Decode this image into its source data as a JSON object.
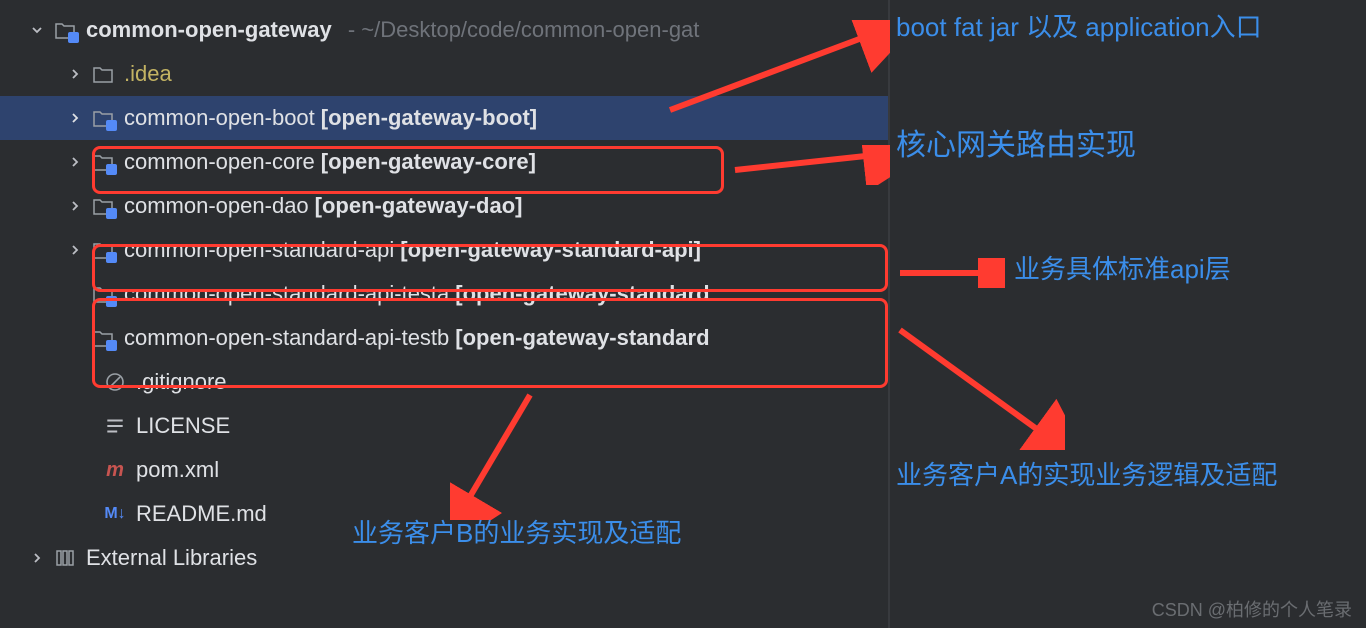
{
  "root": {
    "name": "common-open-gateway",
    "path": "~/Desktop/code/common-open-gat"
  },
  "items": [
    {
      "name": ".idea",
      "type": "folder-idea",
      "indent": 1,
      "chevron": "right"
    },
    {
      "name": "common-open-boot",
      "suffix": "[open-gateway-boot]",
      "type": "module",
      "indent": 1,
      "chevron": "right",
      "selected": true
    },
    {
      "name": "common-open-core",
      "suffix": "[open-gateway-core]",
      "type": "module",
      "indent": 1,
      "chevron": "right"
    },
    {
      "name": "common-open-dao",
      "suffix": "[open-gateway-dao]",
      "type": "module",
      "indent": 1,
      "chevron": "right"
    },
    {
      "name": "common-open-standard-api",
      "suffix": "[open-gateway-standard-api]",
      "type": "module",
      "indent": 1,
      "chevron": "right"
    },
    {
      "name": "common-open-standard-api-testa",
      "suffix": "[open-gateway-standard",
      "type": "module",
      "indent": 1,
      "chevron": "none"
    },
    {
      "name": "common-open-standard-api-testb",
      "suffix": "[open-gateway-standard",
      "type": "module",
      "indent": 1,
      "chevron": "none"
    },
    {
      "name": ".gitignore",
      "type": "gitignore",
      "indent": 2,
      "chevron": "none"
    },
    {
      "name": "LICENSE",
      "type": "text",
      "indent": 2,
      "chevron": "none"
    },
    {
      "name": "pom.xml",
      "type": "maven",
      "indent": 2,
      "chevron": "none"
    },
    {
      "name": "README.md",
      "type": "markdown",
      "indent": 2,
      "chevron": "none"
    }
  ],
  "external": "External Libraries",
  "annotations": {
    "a1": "boot fat jar 以及 application入口",
    "a2": "核心网关路由实现",
    "a3": "业务具体标准api层",
    "a4": "业务客户A的实现业务逻辑及适配",
    "a5": "业务客户B的业务实现及适配"
  },
  "watermark": "CSDN @柏修的个人笔录"
}
